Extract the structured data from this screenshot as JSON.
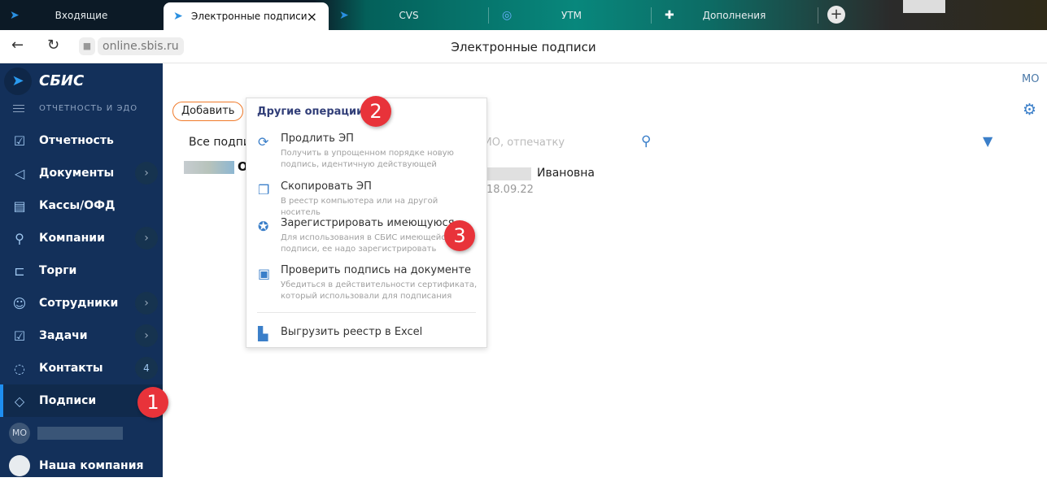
{
  "tabs": [
    {
      "label": "Входящие"
    },
    {
      "label": "Электронные подписи",
      "close": "×"
    },
    {
      "label": "CVS"
    },
    {
      "label": "УТМ"
    },
    {
      "label": "Дополнения"
    }
  ],
  "new_tab": "+",
  "address": {
    "url": "online.sbis.ru",
    "page_title": "Электронные подписи"
  },
  "sidebar": {
    "brand": "СБИС",
    "section": "ОТЧЕТНОСТЬ И ЭДО",
    "items": [
      {
        "label": "Отчетность"
      },
      {
        "label": "Документы"
      },
      {
        "label": "Кассы/ОФД"
      },
      {
        "label": "Компании"
      },
      {
        "label": "Торги"
      },
      {
        "label": "Сотрудники"
      },
      {
        "label": "Задачи"
      },
      {
        "label": "Контакты",
        "count": "4"
      },
      {
        "label": "Подписи"
      }
    ],
    "user_initials": "МО",
    "company": "Наша компания"
  },
  "main": {
    "add_button": "Добавить",
    "filter_label": "Все подпис",
    "search_placeholder": "ИО, отпечатку",
    "row_name": "Ивановна",
    "row_prefix": "О",
    "row_date": "18.09.22",
    "user_initials": "МО"
  },
  "popup": {
    "title": "Другие операции",
    "items": [
      {
        "title": "Продлить ЭП",
        "desc": "Получить в упрощенном порядке новую подпись, идентичную действующей"
      },
      {
        "title": "Скопировать ЭП",
        "desc": "В реестр компьютера или на другой носитель"
      },
      {
        "title": "Зарегистрировать имеющуюся",
        "desc": "Для использования в СБИС имеющейся подписи, ее надо зарегистрировать"
      },
      {
        "title": "Проверить подпись на документе",
        "desc": "Убедиться в действительности сертификата, который использовали для подписания"
      },
      {
        "title": "Выгрузить реестр в Excel"
      }
    ]
  },
  "badges": [
    "1",
    "2",
    "3"
  ]
}
